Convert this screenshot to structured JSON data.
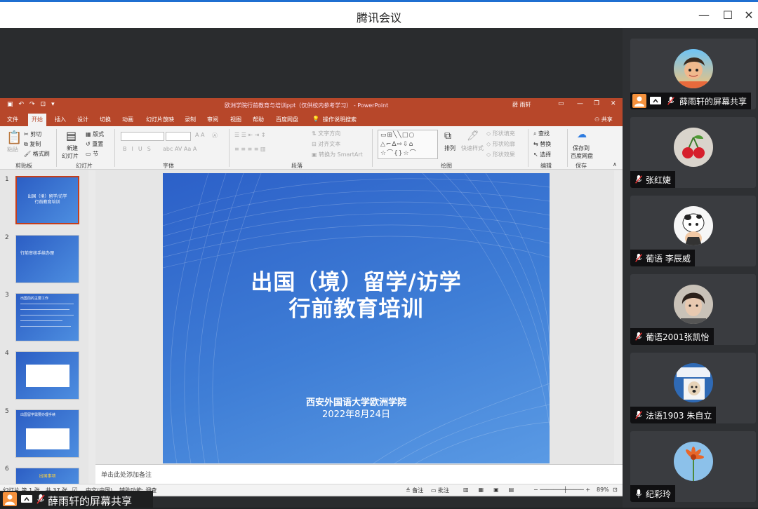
{
  "app": {
    "title": "腾讯会议"
  },
  "ppt": {
    "file_title": "欧洲学院行前教育与培训ppt（仅供校内参考学习） - PowerPoint",
    "user": "薛 雨轩",
    "menus": [
      "文件",
      "开始",
      "插入",
      "设计",
      "切换",
      "动画",
      "幻灯片放映",
      "录制",
      "审阅",
      "视图",
      "帮助",
      "百度网盘",
      "操作说明搜索"
    ],
    "share_label": "共享",
    "ribbon": {
      "clipboard": {
        "paste": "粘贴",
        "cut": "剪切",
        "copy": "复制",
        "format_painter": "格式刷",
        "label": "剪贴板"
      },
      "slides": {
        "new_slide": "新建",
        "new_slide2": "幻灯片",
        "layout": "版式",
        "reset": "重置",
        "section": "节",
        "label": "幻灯片"
      },
      "font": {
        "label": "字体"
      },
      "paragraph": {
        "text_direction": "文字方向",
        "align_text": "对齐文本",
        "smartart": "转换为 SmartArt",
        "label": "段落"
      },
      "drawing": {
        "arrange": "排列",
        "quick_styles": "快速样式",
        "shape_fill": "形状填充",
        "shape_outline": "形状轮廓",
        "shape_effects": "形状效果",
        "label": "绘图"
      },
      "editing": {
        "find": "查找",
        "replace": "替换",
        "select": "选择",
        "label": "编辑"
      },
      "save": {
        "save_to": "保存到",
        "baidu": "百度网盘",
        "label": "保存"
      }
    },
    "thumbnails": [
      {
        "num": "1",
        "text1": "出国（境）留学/访学",
        "text2": "行前教育培训"
      },
      {
        "num": "2",
        "text1": "行前审核手续办理"
      },
      {
        "num": "3",
        "text1": "出国前的主要工作"
      },
      {
        "num": "4"
      },
      {
        "num": "5",
        "text1": "出国留学需要办理手续"
      },
      {
        "num": "6",
        "text1": "出国事项"
      }
    ],
    "slide": {
      "title_line1": "出国（境）留学/访学",
      "title_line2": "行前教育培训",
      "org": "西安外国语大学欧洲学院",
      "date": "2022年8月24日"
    },
    "notes_placeholder": "单击此处添加备注",
    "status": {
      "slide_pos": "幻灯片 第 1 张，共 37 张",
      "lang": "中文(中国)",
      "accessibility": "辅助功能: 调查",
      "notes": "备注",
      "comments": "批注",
      "zoom": "89%"
    }
  },
  "share_bar": {
    "name": "薛雨轩的屏幕共享"
  },
  "participants": [
    {
      "name": "薛雨轩的屏幕共享",
      "avatar": "cartoon-avatar"
    },
    {
      "name": "张红婕",
      "avatar": "cherry-avatar"
    },
    {
      "name": "葡语 李辰威",
      "avatar": "cow-avatar"
    },
    {
      "name": "葡语2001张凯怡",
      "avatar": "photo-avatar"
    },
    {
      "name": "法语1903 朱自立",
      "avatar": "dog-avatar"
    },
    {
      "name": "纪彩玲",
      "avatar": "flower-avatar"
    }
  ],
  "colors": {
    "ppt_red": "#b7472a",
    "slide_blue": "#2c60c8",
    "accent": "#1f6fd1"
  }
}
